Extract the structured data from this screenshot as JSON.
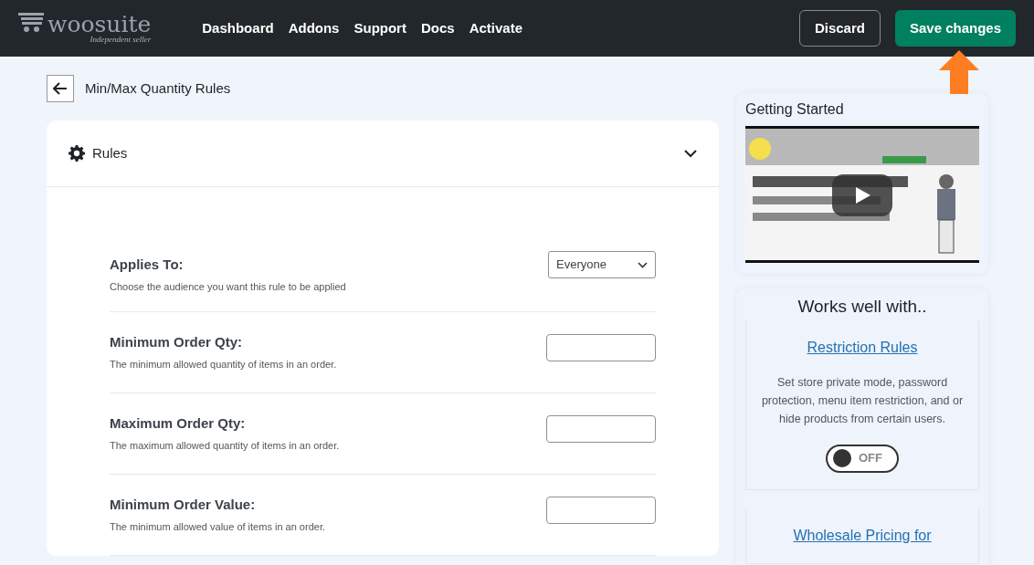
{
  "logo": {
    "name": "woosuite",
    "tagline": "Independent seller"
  },
  "nav": [
    "Dashboard",
    "Addons",
    "Support",
    "Docs",
    "Activate"
  ],
  "actions": {
    "discard": "Discard",
    "save": "Save changes"
  },
  "page_title": "Min/Max Quantity Rules",
  "panel": {
    "title": "Rules",
    "expanded": true
  },
  "rules": [
    {
      "kind": "select",
      "label": "Applies To:",
      "hint": "Choose the audience you want this rule to be applied",
      "value": "Everyone"
    },
    {
      "kind": "input",
      "label": "Minimum Order Qty:",
      "hint": "The minimum allowed quantity of items in an order."
    },
    {
      "kind": "input",
      "label": "Maximum Order Qty:",
      "hint": "The maximum allowed quantity of items in an order."
    },
    {
      "kind": "input",
      "label": "Minimum Order Value:",
      "hint": "The minimum allowed value of items in an order."
    }
  ],
  "getting_started": {
    "title": "Getting Started"
  },
  "works_well": {
    "title": "Works well with..",
    "addons": [
      {
        "name": "Restriction Rules",
        "description": "Set store private mode, password protection, menu item restriction, and or hide products from certain users.",
        "toggle": {
          "on": false,
          "label": "OFF"
        }
      },
      {
        "name": "Wholesale Pricing for"
      }
    ]
  }
}
